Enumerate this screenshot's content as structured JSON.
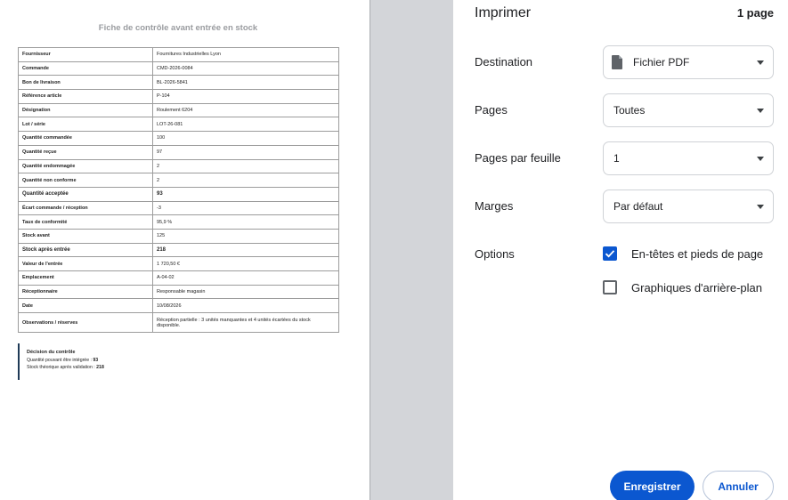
{
  "document": {
    "title": "Fiche de contrôle avant entrée en stock",
    "rows": [
      {
        "key": "Fournisseur",
        "value": "Fournitures Industrielles Lyon"
      },
      {
        "key": "Commande",
        "value": "CMD-2026-0084"
      },
      {
        "key": "Bon de livraison",
        "value": "BL-2026-5841"
      },
      {
        "key": "Référence article",
        "value": "P-104"
      },
      {
        "key": "Désignation",
        "value": "Roulement 6204"
      },
      {
        "key": "Lot / série",
        "value": "LOT-26-081"
      },
      {
        "key": "Quantité commandée",
        "value": "100"
      },
      {
        "key": "Quantité reçue",
        "value": "97"
      },
      {
        "key": "Quantité endommagée",
        "value": "2"
      },
      {
        "key": "Quantité non conforme",
        "value": "2"
      },
      {
        "key": "Quantité acceptée",
        "value": "93"
      },
      {
        "key": "Écart commande / réception",
        "value": "-3"
      },
      {
        "key": "Taux de conformité",
        "value": "95,9 %"
      },
      {
        "key": "Stock avant",
        "value": "125"
      },
      {
        "key": "Stock après entrée",
        "value": "218"
      },
      {
        "key": "Valeur de l'entrée",
        "value": "1 720,50 €"
      },
      {
        "key": "Emplacement",
        "value": "A-04-02"
      },
      {
        "key": "Réceptionnaire",
        "value": "Responsable magasin"
      },
      {
        "key": "Date",
        "value": "10/08/2026"
      },
      {
        "key": "Observations / réserves",
        "value": "Réception partielle : 3 unités manquantes et 4 unités écartées du stock disponible."
      }
    ],
    "decision": {
      "heading": "Décision du contrôle",
      "line1_label": "Quantité pouvant être intégrée :",
      "line1_value": "93",
      "line2_label": "Stock théorique après validation :",
      "line2_value": "218"
    }
  },
  "print_panel": {
    "title": "Imprimer",
    "page_count": "1 page",
    "destination": {
      "label": "Destination",
      "value": "Fichier PDF",
      "icon": "file-icon"
    },
    "pages": {
      "label": "Pages",
      "value": "Toutes"
    },
    "pages_per_sheet": {
      "label": "Pages par feuille",
      "value": "1"
    },
    "margins": {
      "label": "Marges",
      "value": "Par défaut"
    },
    "options": {
      "label": "Options",
      "headers_footers": {
        "label": "En-têtes et pieds de page",
        "checked": true
      },
      "background_graphics": {
        "label": "Graphiques d'arrière-plan",
        "checked": false
      }
    },
    "save_label": "Enregistrer",
    "cancel_label": "Annuler",
    "colors": {
      "accent": "#0b57d0"
    }
  }
}
